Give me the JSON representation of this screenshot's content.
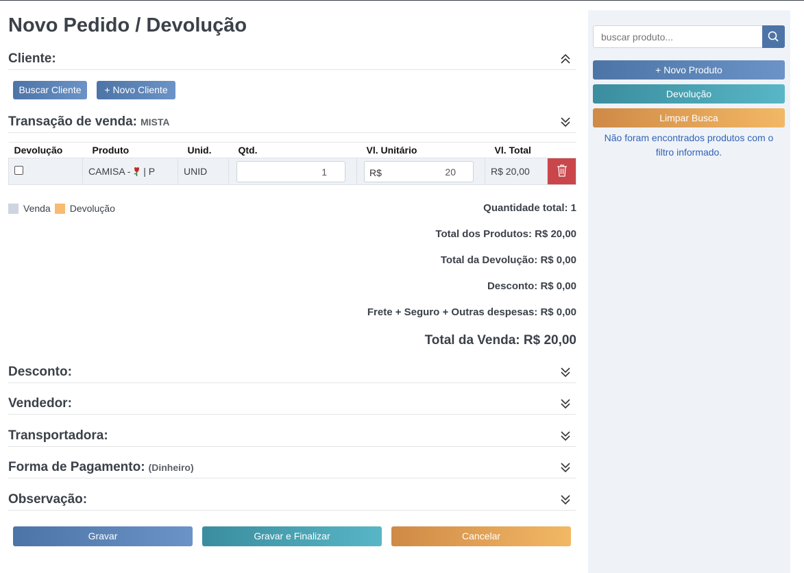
{
  "page": {
    "title": "Novo Pedido / Devolução"
  },
  "cliente": {
    "title": "Cliente:",
    "buscar_label": "Buscar Cliente",
    "novo_label": "+ Novo Cliente"
  },
  "transacao": {
    "title": "Transação de venda:",
    "tipo": "MISTA"
  },
  "table": {
    "headers": [
      "Devolução",
      "Produto",
      "Unid.",
      "Qtd.",
      "Vl. Unitário",
      "Vl. Total"
    ],
    "rows": [
      {
        "devolucao": false,
        "produto_nome": "CAMISA - ",
        "produto_variacao": " | P",
        "unid": "UNID",
        "qtd": "1",
        "vl_prefix": "R$",
        "vl_unitario": "20",
        "vl_total": "R$ 20,00"
      }
    ]
  },
  "legend": {
    "venda": "Venda",
    "devolucao": "Devolução"
  },
  "totals": {
    "quantidade": "Quantidade total: 1",
    "produtos": "Total dos Produtos: R$ 20,00",
    "devolucao": "Total da Devolução: R$ 0,00",
    "desconto": "Desconto: R$ 0,00",
    "frete": "Frete + Seguro + Outras despesas: R$ 0,00",
    "venda": "Total da Venda: R$ 20,00"
  },
  "sections": {
    "desconto": "Desconto:",
    "vendedor": "Vendedor:",
    "transportadora": "Transportadora:",
    "pagamento": "Forma de Pagamento:",
    "pagamento_sub": "(Dinheiro)",
    "observacao": "Observação:"
  },
  "actions": {
    "gravar": "Gravar",
    "gravar_finalizar": "Gravar e Finalizar",
    "cancelar": "Cancelar"
  },
  "sidebar": {
    "search_placeholder": "buscar produto...",
    "novo_produto": "+ Novo Produto",
    "devolucao": "Devolução",
    "limpar": "Limpar Busca",
    "message": "Não foram encontrados produtos com o filtro informado."
  },
  "colors": {
    "primary": "#4d74a6",
    "teal": "#3a9aa8",
    "orange": "#d08a46",
    "danger": "#c9474b",
    "venda_swatch": "#cdd6e0",
    "devolucao_swatch": "#f7bb72"
  }
}
